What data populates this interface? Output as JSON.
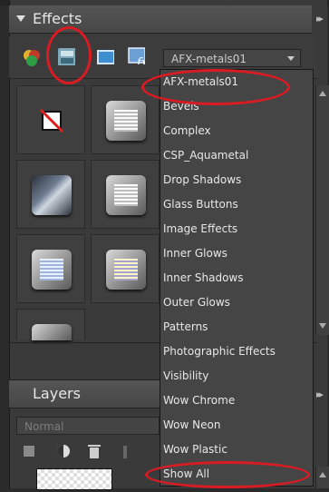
{
  "effects_panel": {
    "title": "Effects"
  },
  "library_dropdown": {
    "selected": "AFX-metals01"
  },
  "menu_items": [
    "AFX-metals01",
    "Bevels",
    "Complex",
    "CSP_Aquametal",
    "Drop Shadows",
    "Glass Buttons",
    "Image Effects",
    "Inner Glows",
    "Inner Shadows",
    "Outer Glows",
    "Patterns",
    "Photographic Effects",
    "Visibility",
    "Wow Chrome",
    "Wow Neon",
    "Wow Plastic",
    "Show All"
  ],
  "layers_panel": {
    "title": "Layers",
    "blend_mode": "Normal"
  },
  "colors": {
    "highlight_red": "#d91b23",
    "panel_bg": "#3a3a3a"
  }
}
